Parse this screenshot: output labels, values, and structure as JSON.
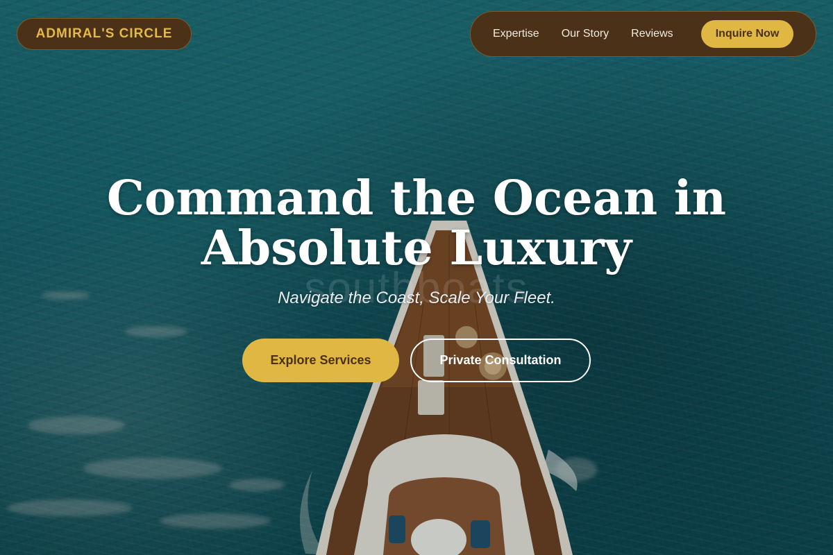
{
  "brand": {
    "name": "ADMIRAL'S CIRCLE"
  },
  "nav": {
    "links": [
      "Expertise",
      "Our Story",
      "Reviews"
    ],
    "cta_label": "Inquire Now"
  },
  "hero": {
    "title_line1": "Command the Ocean in",
    "title_line2": "Absolute Luxury",
    "ghost_text": "southboats",
    "subtitle": "Navigate the Coast, Scale Your Fleet.",
    "primary_button": "Explore Services",
    "secondary_button": "Private Consultation"
  },
  "colors": {
    "accent_gold": "#e0b743",
    "brand_brown": "#4a3117",
    "ocean_teal": "#16616a"
  }
}
